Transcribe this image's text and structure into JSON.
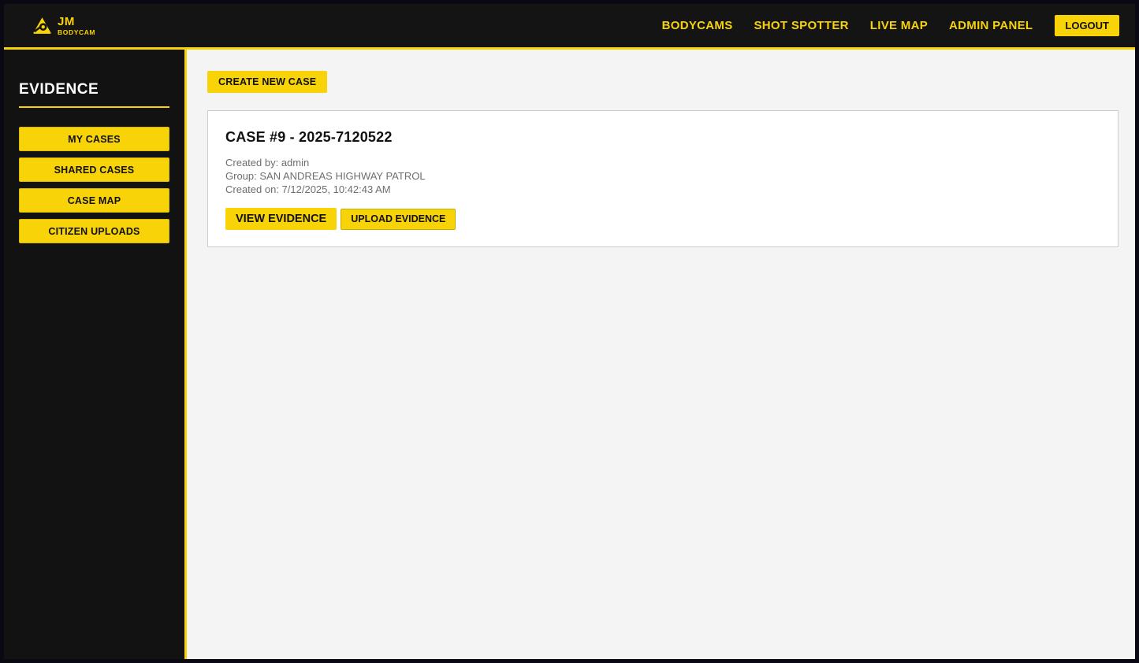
{
  "colors": {
    "accent": "#f7d308",
    "frame-bg": "#0a0812",
    "navbar-bg": "#141414",
    "sidebar-bg": "#121212",
    "content-bg": "#f4f4f4",
    "card-border": "#cccccc",
    "meta-text": "#6e6e6e"
  },
  "brand": {
    "title": "JM",
    "subtitle": "BODYCAM",
    "logo_icon": "triangle-lens-icon"
  },
  "navbar": {
    "items": [
      {
        "label": "BODYCAMS"
      },
      {
        "label": "SHOT SPOTTER"
      },
      {
        "label": "LIVE MAP"
      },
      {
        "label": "ADMIN PANEL"
      }
    ],
    "logout_label": "LOGOUT"
  },
  "sidebar": {
    "title": "EVIDENCE",
    "items": [
      {
        "label": "MY CASES"
      },
      {
        "label": "SHARED CASES"
      },
      {
        "label": "CASE MAP"
      },
      {
        "label": "CITIZEN UPLOADS"
      }
    ]
  },
  "main": {
    "create_button_label": "CREATE NEW CASE",
    "case": {
      "title": "CASE #9 - 2025-7120522",
      "created_by": "Created by: admin",
      "group": "Group: SAN ANDREAS HIGHWAY PATROL",
      "created_on": "Created on: 7/12/2025, 10:42:43 AM",
      "view_button_label": "VIEW EVIDENCE",
      "upload_button_label": "UPLOAD EVIDENCE"
    }
  }
}
